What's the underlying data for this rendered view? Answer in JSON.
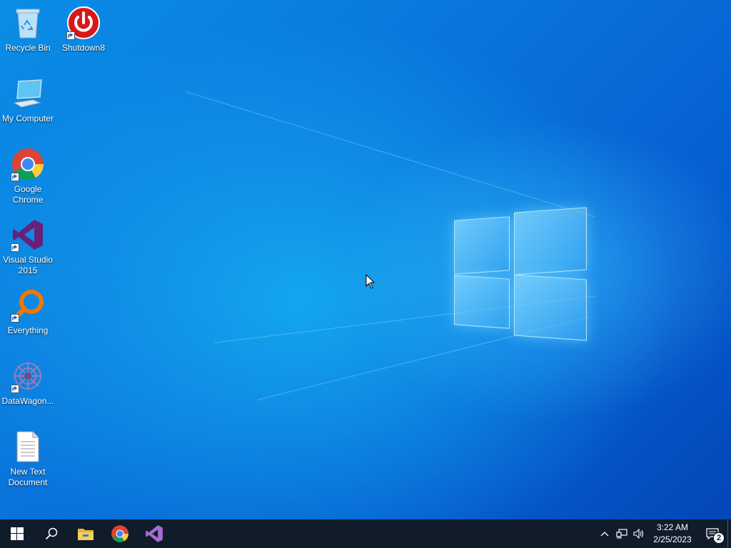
{
  "desktop": {
    "icons": [
      {
        "label": "Recycle Bin",
        "icon": "recycle-bin-icon",
        "shortcut": false
      },
      {
        "label": "Shutdown8",
        "icon": "power-icon",
        "shortcut": true
      },
      {
        "label": "My Computer",
        "icon": "computer-icon",
        "shortcut": false
      },
      {
        "label": "Google Chrome",
        "icon": "chrome-icon",
        "shortcut": true
      },
      {
        "label": "Visual Studio 2015",
        "icon": "visual-studio-icon",
        "shortcut": true
      },
      {
        "label": "Everything",
        "icon": "everything-search-icon",
        "shortcut": true
      },
      {
        "label": "DataWagon...",
        "icon": "datawagon-icon",
        "shortcut": true
      },
      {
        "label": "New Text Document",
        "icon": "text-document-icon",
        "shortcut": false
      }
    ]
  },
  "taskbar": {
    "start": "windows-start-icon",
    "search": "search-icon",
    "pinned": [
      "file-explorer-icon",
      "chrome-icon",
      "visual-studio-icon"
    ],
    "tray": {
      "chevron": "chevron-up-icon",
      "network": "network-icon",
      "volume": "volume-icon"
    },
    "clock": {
      "time": "3:22 AM",
      "date": "2/25/2023"
    },
    "notifications": {
      "count": "2"
    }
  },
  "colors": {
    "taskbar": "#101c2a",
    "accent": "#0a78de"
  }
}
